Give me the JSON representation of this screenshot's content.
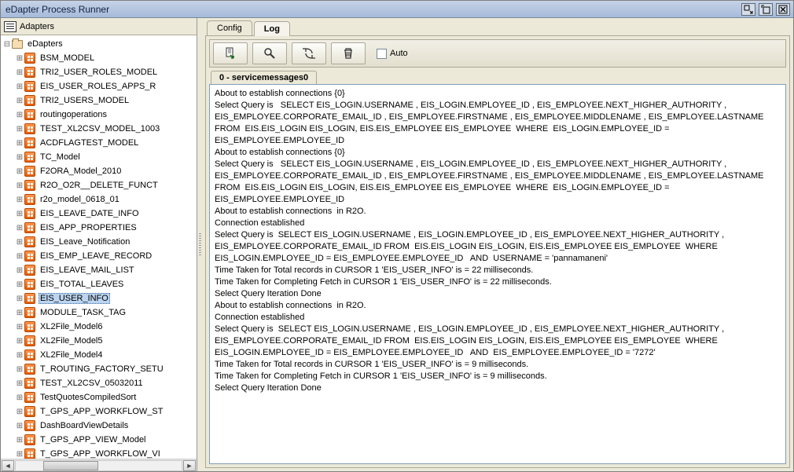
{
  "window": {
    "title": "eDapter Process Runner"
  },
  "sidebar": {
    "header": "Adapters",
    "root": {
      "label": "eDapters",
      "expanded": true
    },
    "selected_index": 18,
    "items": [
      "BSM_MODEL",
      "TRI2_USER_ROLES_MODEL",
      "EIS_USER_ROLES_APPS_R",
      "TRI2_USERS_MODEL",
      "routingoperations",
      "TEST_XL2CSV_MODEL_1003",
      "ACDFLAGTEST_MODEL",
      "TC_Model",
      "F2ORA_Model_2010",
      "R2O_O2R__DELETE_FUNCT",
      "r2o_model_0618_01",
      "EIS_LEAVE_DATE_INFO",
      "EIS_APP_PROPERTIES",
      "EIS_Leave_Notification",
      "EIS_EMP_LEAVE_RECORD",
      "EIS_LEAVE_MAIL_LIST",
      "EIS_TOTAL_LEAVES",
      "EIS_USER_INFO",
      "MODULE_TASK_TAG",
      "XL2File_Model6",
      "XL2File_Model5",
      "XL2File_Model4",
      "T_ROUTING_FACTORY_SETU",
      "TEST_XL2CSV_05032011",
      "TestQuotesCompiledSort",
      "T_GPS_APP_WORKFLOW_ST",
      "DashBoardViewDetails",
      "T_GPS_APP_VIEW_Model",
      "T_GPS_APP_WORKFLOW_VI"
    ]
  },
  "tabs": {
    "items": [
      "Config",
      "Log"
    ],
    "active_index": 1
  },
  "toolbar": {
    "auto_label": "Auto",
    "auto_checked": false
  },
  "subtab": {
    "label": "0 - servicemessages0"
  },
  "log_lines": [
    "About to establish connections {0}",
    "Select Query is   SELECT EIS_LOGIN.USERNAME , EIS_LOGIN.EMPLOYEE_ID , EIS_EMPLOYEE.NEXT_HIGHER_AUTHORITY , EIS_EMPLOYEE.CORPORATE_EMAIL_ID , EIS_EMPLOYEE.FIRSTNAME , EIS_EMPLOYEE.MIDDLENAME , EIS_EMPLOYEE.LASTNAME FROM  EIS.EIS_LOGIN EIS_LOGIN, EIS.EIS_EMPLOYEE EIS_EMPLOYEE  WHERE  EIS_LOGIN.EMPLOYEE_ID = EIS_EMPLOYEE.EMPLOYEE_ID",
    "About to establish connections {0}",
    "Select Query is   SELECT EIS_LOGIN.USERNAME , EIS_LOGIN.EMPLOYEE_ID , EIS_EMPLOYEE.NEXT_HIGHER_AUTHORITY , EIS_EMPLOYEE.CORPORATE_EMAIL_ID , EIS_EMPLOYEE.FIRSTNAME , EIS_EMPLOYEE.MIDDLENAME , EIS_EMPLOYEE.LASTNAME FROM  EIS.EIS_LOGIN EIS_LOGIN, EIS.EIS_EMPLOYEE EIS_EMPLOYEE  WHERE  EIS_LOGIN.EMPLOYEE_ID = EIS_EMPLOYEE.EMPLOYEE_ID",
    "About to establish connections  in R2O.",
    "Connection established",
    "Select Query is  SELECT EIS_LOGIN.USERNAME , EIS_LOGIN.EMPLOYEE_ID , EIS_EMPLOYEE.NEXT_HIGHER_AUTHORITY , EIS_EMPLOYEE.CORPORATE_EMAIL_ID FROM  EIS.EIS_LOGIN EIS_LOGIN, EIS.EIS_EMPLOYEE EIS_EMPLOYEE  WHERE  EIS_LOGIN.EMPLOYEE_ID = EIS_EMPLOYEE.EMPLOYEE_ID   AND  USERNAME = 'pannamaneni'",
    "Time Taken for Total records in CURSOR 1 'EIS_USER_INFO' is = 22 milliseconds.",
    "Time Taken for Completing Fetch in CURSOR 1 'EIS_USER_INFO' is = 22 milliseconds.",
    "Select Query Iteration Done",
    "About to establish connections  in R2O.",
    "Connection established",
    "Select Query is  SELECT EIS_LOGIN.USERNAME , EIS_LOGIN.EMPLOYEE_ID , EIS_EMPLOYEE.NEXT_HIGHER_AUTHORITY , EIS_EMPLOYEE.CORPORATE_EMAIL_ID FROM  EIS.EIS_LOGIN EIS_LOGIN, EIS.EIS_EMPLOYEE EIS_EMPLOYEE  WHERE  EIS_LOGIN.EMPLOYEE_ID = EIS_EMPLOYEE.EMPLOYEE_ID   AND  EIS_EMPLOYEE.EMPLOYEE_ID = '7272'",
    "Time Taken for Total records in CURSOR 1 'EIS_USER_INFO' is = 9 milliseconds.",
    "Time Taken for Completing Fetch in CURSOR 1 'EIS_USER_INFO' is = 9 milliseconds.",
    "Select Query Iteration Done"
  ]
}
